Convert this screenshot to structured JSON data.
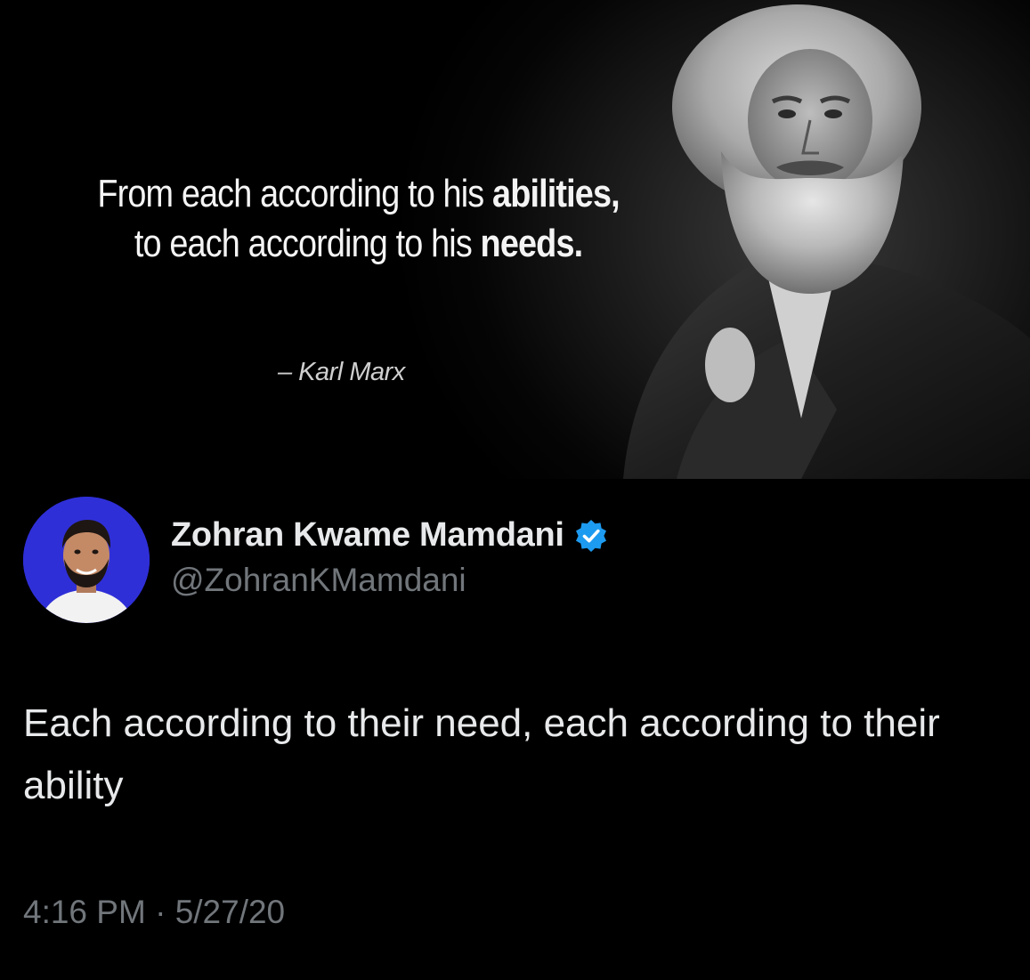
{
  "quote_image": {
    "line1_plain": "From each according to his ",
    "line1_bold": "abilities,",
    "line2_plain": "to each according to his ",
    "line2_bold": "needs.",
    "attribution": "– Karl Marx"
  },
  "tweet": {
    "display_name": "Zohran Kwame Mamdani",
    "handle": "@ZohranKMamdani",
    "verified_icon": "verified-badge-icon",
    "text": "Each according to their need, each according to their ability",
    "time": "4:16 PM",
    "separator": " · ",
    "date": "5/27/20"
  },
  "colors": {
    "background": "#000000",
    "primary_text": "#e7e9ea",
    "secondary_text": "#71767b",
    "verified_blue": "#1d9bf0",
    "avatar_bg": "#2f2fd8"
  }
}
